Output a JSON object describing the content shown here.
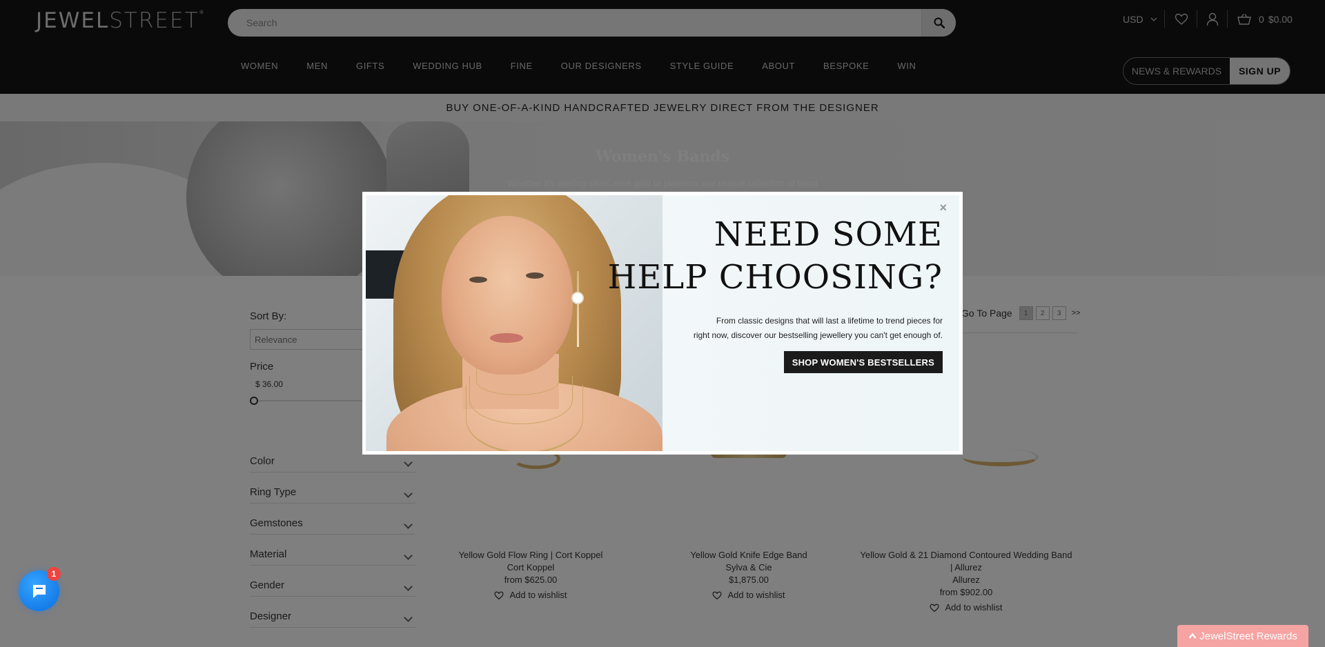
{
  "header": {
    "logo_main": "JEWEL",
    "logo_thin": "STREET",
    "logo_mark": "®",
    "search_placeholder": "Search",
    "currency": "USD",
    "cart_count": "0",
    "cart_total": "$0.00",
    "nav": [
      "WOMEN",
      "MEN",
      "GIFTS",
      "WEDDING HUB",
      "FINE",
      "OUR DESIGNERS",
      "STYLE GUIDE",
      "ABOUT",
      "BESPOKE",
      "WIN"
    ],
    "news_label": "NEWS & REWARDS",
    "signup_label": "SIGN UP"
  },
  "promo_strip": "BUY ONE-OF-A-KIND HANDCRAFTED JEWELRY DIRECT FROM THE DESIGNER",
  "banner": {
    "title": "Women's Bands",
    "subtitle": "Whether it's sterling silver, rose gold or platinum, our unique collection of band"
  },
  "sidebar": {
    "sort_label": "Sort By:",
    "sort_value": "Relevance",
    "price_label": "Price",
    "price_min": "$ 36.00",
    "filters": [
      "Color",
      "Ring Type",
      "Gemstones",
      "Material",
      "Gender",
      "Designer"
    ]
  },
  "pager": {
    "label": "Go To Page",
    "pages": [
      "1",
      "2",
      "3"
    ],
    "next": ">>",
    "active": "1"
  },
  "products": [
    {
      "name": "Yellow Gold Flow Ring | Cort Koppel",
      "designer": "Cort Koppel",
      "price": "from $625.00",
      "wishlist": "Add to wishlist"
    },
    {
      "name": "Yellow Gold Knife Edge Band",
      "designer": "Sylva & Cie",
      "price": "$1,875.00",
      "wishlist": "Add to wishlist"
    },
    {
      "name": "Yellow Gold & 21 Diamond Contoured Wedding Band | Allurez",
      "designer": "Allurez",
      "price": "from $902.00",
      "wishlist": "Add to wishlist"
    }
  ],
  "modal": {
    "close": "×",
    "heading_line1": "NEED SOME",
    "heading_line2": "HELP CHOOSING?",
    "text_line1": "From classic designs that will last a lifetime to trend pieces for",
    "text_line2": "right now, discover our bestselling jewellery you can't get enough of.",
    "cta": "SHOP WOMEN'S BESTSELLERS"
  },
  "chat": {
    "badge": "1"
  },
  "rewards": {
    "label": "JewelStreet Rewards",
    "arrow": "^"
  },
  "colors": {
    "header_bg": "#151515",
    "accent_rewards": "#f5a3a3",
    "chat_blue": "#0a6ee0",
    "badge_red": "#f0433c"
  }
}
